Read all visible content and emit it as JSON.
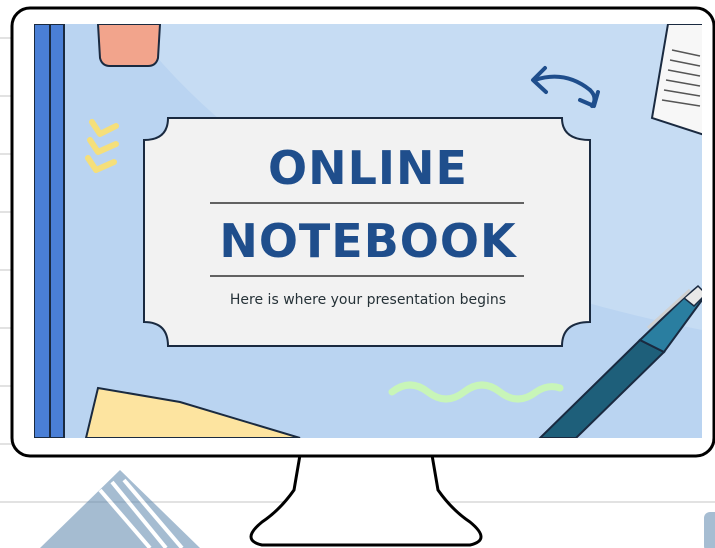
{
  "slide": {
    "title_line1": "ONLINE",
    "title_line2": "NOTEBOOK",
    "subtitle": "Here is where your presentation begins"
  },
  "colors": {
    "screen_bg": "#c6dcf3",
    "title": "#1f4e8c",
    "accent_blue": "#4a7fd6",
    "card_bg": "#f2f2f2",
    "pen": "#1e5f7a",
    "squiggle": "#c8f5b8",
    "note_yellow": "#fde4a0"
  },
  "icons": [
    "curved-arrows-icon",
    "chevron-marks-icon",
    "pen-icon",
    "paper-note-icon",
    "sticky-note-icon",
    "eraser-icon",
    "squiggle-icon"
  ]
}
